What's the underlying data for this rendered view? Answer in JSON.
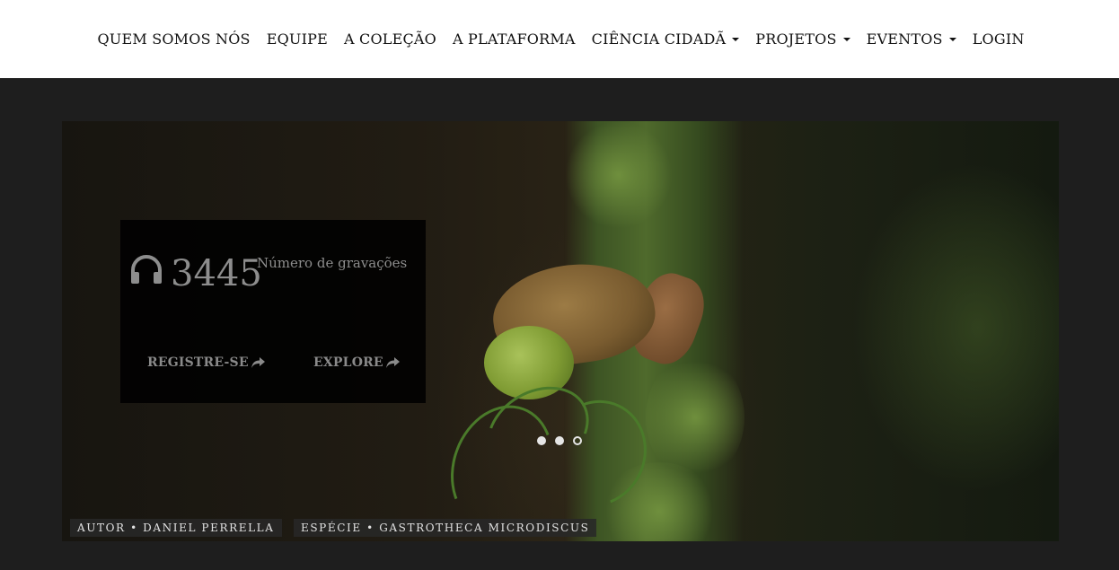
{
  "nav": {
    "items": [
      {
        "label": "QUEM SOMOS NÓS",
        "dropdown": false
      },
      {
        "label": "EQUIPE",
        "dropdown": false
      },
      {
        "label": "A COLEÇÃO",
        "dropdown": false
      },
      {
        "label": "A PLATAFORMA",
        "dropdown": false
      },
      {
        "label": "CIÊNCIA CIDADÃ",
        "dropdown": true
      },
      {
        "label": "PROJETOS",
        "dropdown": true
      },
      {
        "label": "EVENTOS",
        "dropdown": true
      },
      {
        "label": "LOGIN",
        "dropdown": false
      }
    ]
  },
  "stats": {
    "icon": "headphones-icon",
    "count": "3445",
    "label": "Número de gravações"
  },
  "actions": {
    "register_label": "REGISTRE-SE",
    "explore_label": "EXPLORE",
    "icon": "share-arrow-icon"
  },
  "carousel": {
    "slide_count": 3,
    "active_index": 2
  },
  "captions": {
    "author": "AUTOR • DANIEL PERRELLA",
    "species": "ESPÉCIE • GASTROTHECA MICRODISCUS"
  },
  "colors": {
    "page_bg": "#1e1e1e",
    "nav_bg": "#ffffff",
    "overlay_bg": "#000000",
    "muted_text": "#8d8d8d"
  }
}
